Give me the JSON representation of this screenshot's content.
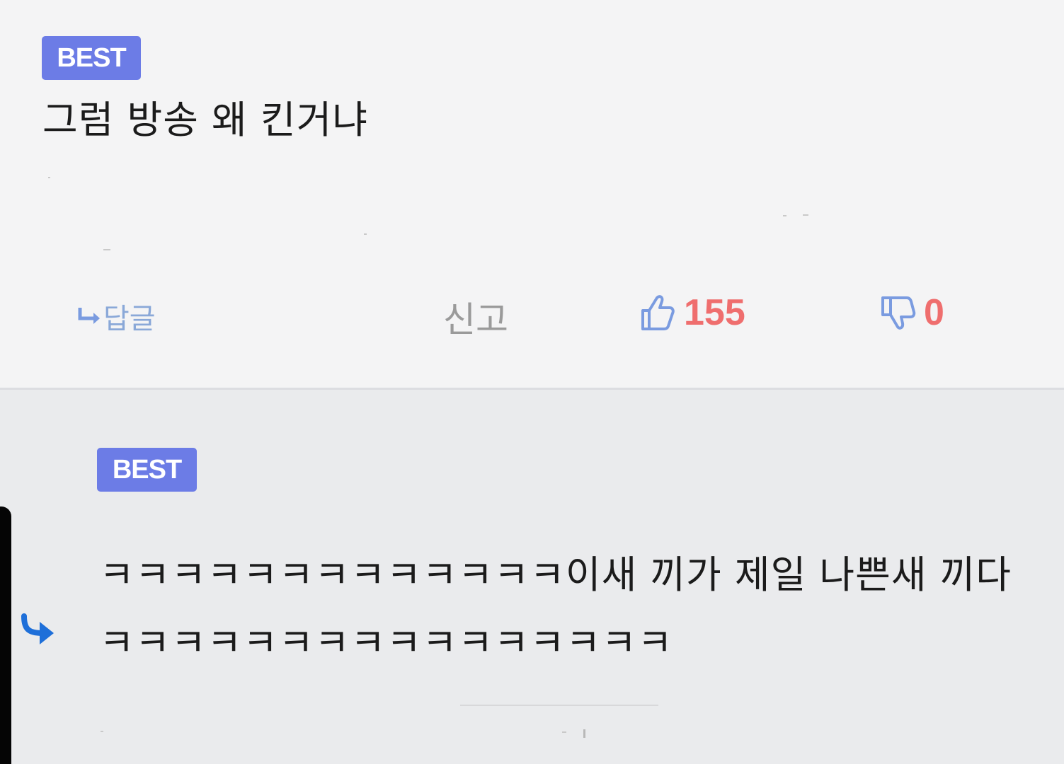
{
  "comments": [
    {
      "badge": "BEST",
      "text": "그럼 방송 왜 킨거냐",
      "actions": {
        "reply_label": "답글",
        "report_label": "신고",
        "like_count": "155",
        "dislike_count": "0"
      },
      "icons": [
        "reply-arrow-icon",
        "thumbs-up-icon",
        "thumbs-down-icon"
      ]
    },
    {
      "badge": "BEST",
      "text": "ㅋㅋㅋㅋㅋㅋㅋㅋㅋㅋㅋㅋㅋ이새 끼가 제일 나쁜새 끼다 ㅋㅋㅋㅋㅋㅋㅋㅋㅋㅋㅋㅋㅋㅋㅋㅋ",
      "icons": [
        "nested-reply-arrow-icon"
      ]
    }
  ],
  "colors": {
    "badge": "#6c7ce6",
    "count": "#ef6e6e",
    "reply_link": "#8aa8d8",
    "icon_blue": "#7a9be0",
    "nested_arrow": "#1e6fd9"
  }
}
